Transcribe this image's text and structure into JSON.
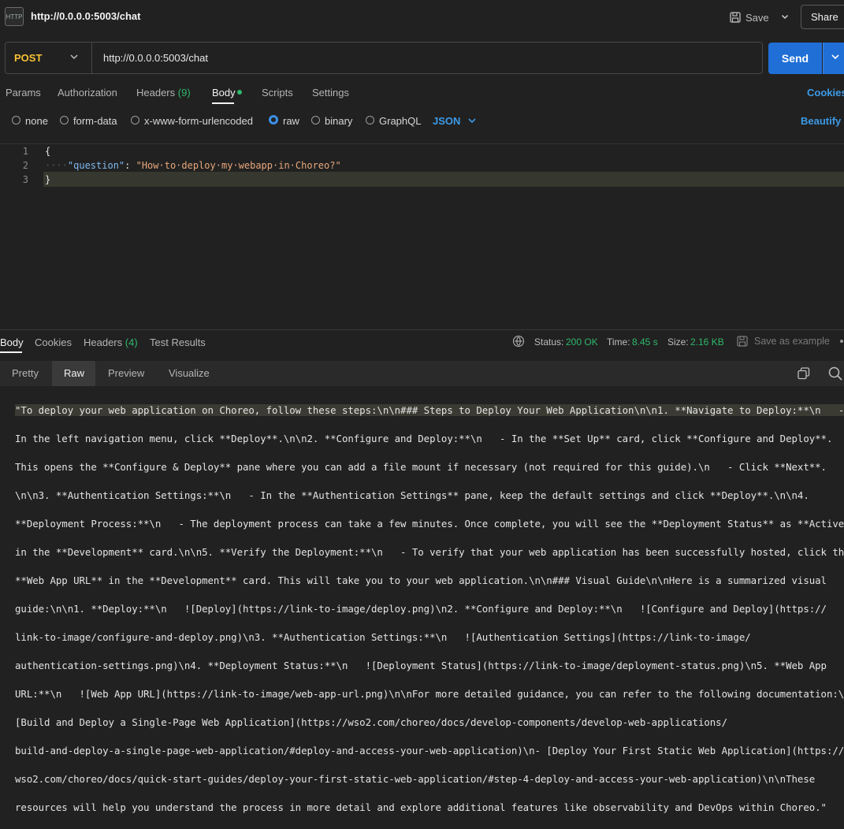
{
  "window": {
    "tab_title": "http://0.0.0.0:5003/chat",
    "http_icon_label": "HTTP",
    "save_label": "Save",
    "share_label": "Share"
  },
  "request": {
    "method": "POST",
    "url": "http://0.0.0.0:5003/chat",
    "send_label": "Send",
    "tabs": {
      "params": "Params",
      "authorization": "Authorization",
      "headers": "Headers",
      "headers_count": "(9)",
      "body": "Body",
      "scripts": "Scripts",
      "settings": "Settings"
    },
    "cookies_label": "Cookies",
    "body_types": [
      "none",
      "form-data",
      "x-www-form-urlencoded",
      "raw",
      "binary",
      "GraphQL"
    ],
    "body_type_selected": "raw",
    "format": "JSON",
    "beautify_label": "Beautify",
    "editor": {
      "line_numbers": [
        "1",
        "2",
        "3"
      ],
      "line1": "{",
      "line2_indent": "····",
      "line2_key": "\"question\"",
      "line2_colon": ": ",
      "line2_value": "\"How·to·deploy·my·webapp·in·Choreo?\"",
      "line3": "}"
    }
  },
  "response": {
    "tabs": {
      "body": "Body",
      "cookies": "Cookies",
      "headers": "Headers",
      "headers_count": "(4)",
      "test_results": "Test Results"
    },
    "status_label": "Status:",
    "status_value": "200 OK",
    "time_label": "Time:",
    "time_value": "8.45 s",
    "size_label": "Size:",
    "size_value": "2.16 KB",
    "save_example_label": "Save as example",
    "view_tabs": [
      "Pretty",
      "Raw",
      "Preview",
      "Visualize"
    ],
    "view_selected": "Raw",
    "body_lines": [
      "\"To deploy your web application on Choreo, follow these steps:\\n\\n### Steps to Deploy Your Web Application\\n\\n1. **Navigate to Deploy:**\\n   -",
      "In the left navigation menu, click **Deploy**.\\n\\n2. **Configure and Deploy:**\\n   - In the **Set Up** card, click **Configure and Deploy**.",
      "This opens the **Configure & Deploy** pane where you can add a file mount if necessary (not required for this guide).\\n   - Click **Next**.",
      "\\n\\n3. **Authentication Settings:**\\n   - In the **Authentication Settings** pane, keep the default settings and click **Deploy**.\\n\\n4.",
      "**Deployment Process:**\\n   - The deployment process can take a few minutes. Once complete, you will see the **Deployment Status** as **Active**",
      "in the **Development** card.\\n\\n5. **Verify the Deployment:**\\n   - To verify that your web application has been successfully hosted, click the",
      "**Web App URL** in the **Development** card. This will take you to your web application.\\n\\n### Visual Guide\\n\\nHere is a summarized visual",
      "guide:\\n\\n1. **Deploy:**\\n   ![Deploy](https://link-to-image/deploy.png)\\n2. **Configure and Deploy:**\\n   ![Configure and Deploy](https://",
      "link-to-image/configure-and-deploy.png)\\n3. **Authentication Settings:**\\n   ![Authentication Settings](https://link-to-image/",
      "authentication-settings.png)\\n4. **Deployment Status:**\\n   ![Deployment Status](https://link-to-image/deployment-status.png)\\n5. **Web App",
      "URL:**\\n   ![Web App URL](https://link-to-image/web-app-url.png)\\n\\nFor more detailed guidance, you can refer to the following documentation:\\n-",
      "[Build and Deploy a Single-Page Web Application](https://wso2.com/choreo/docs/develop-components/develop-web-applications/",
      "build-and-deploy-a-single-page-web-application/#deploy-and-access-your-web-application)\\n- [Deploy Your First Static Web Application](https://",
      "wso2.com/choreo/docs/quick-start-guides/deploy-your-first-static-web-application/#step-4-deploy-and-access-your-web-application)\\n\\nThese",
      "resources will help you understand the process in more detail and explore additional features like observability and DevOps within Choreo.\""
    ]
  },
  "colors": {
    "accent": "#1f6fd6",
    "link": "#3c9ae8",
    "method": "#f5c133",
    "success": "#2fb86b",
    "background": "#212121"
  }
}
